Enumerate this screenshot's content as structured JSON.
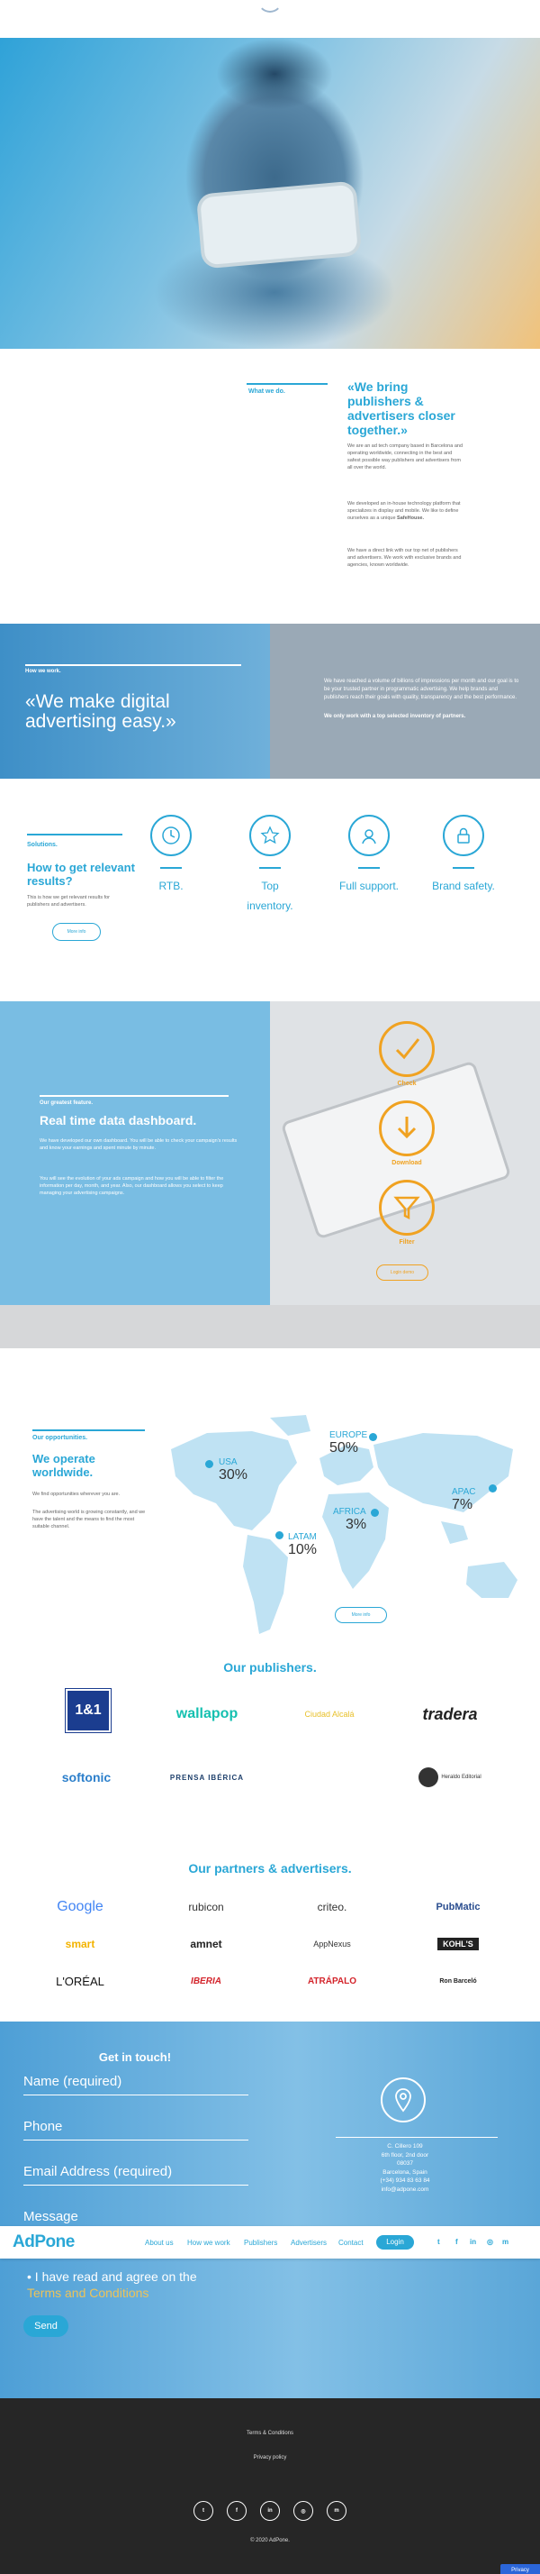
{
  "who": {
    "tag": "What we do.",
    "title": "«We bring publishers & advertisers closer together.»",
    "p1": "We are an ad tech company based in Barcelona and operating worldwide, connecting in the best and safest possible way publishers and advertisers from all over the world.",
    "p2": "We developed an in-house technology platform that specializes in display and mobile. We like to define ourselves as a unique",
    "p2_bold": "SafeHouse.",
    "p3": "We have a direct link with our top net of publishers and advertisers. We work with exclusive brands and agencies, known worldwide."
  },
  "how": {
    "tag": "How we work.",
    "title": "«We make digital advertising easy.»",
    "text": "We have reached a volume of billions of impressions per month and our goal is to be your trusted partner in programmatic advertising. We help brands and publishers reach their goals with quality, transparency and the best performance.",
    "bold": "We only work with a top selected inventory of partners."
  },
  "solutions": {
    "tag": "Solutions.",
    "title": "How to get relevant results?",
    "desc": "This is how we get relevant results for publishers and advertisers.",
    "more": "More info",
    "items": [
      {
        "label": "RTB."
      },
      {
        "label": "Top inventory."
      },
      {
        "label": "Full support."
      },
      {
        "label": "Brand safety."
      }
    ]
  },
  "dashboard": {
    "tag": "Our greatest feature.",
    "title": "Real time data dashboard.",
    "p1": "We have developed our own dashboard. You will be able to check your campaign's results and know your earnings and spent minute by minute.",
    "p2": "You will see the evolution of your ads campaign and how you will be able to filter the information per day, month, and year. Also, our dashboard allows you select to keep managing your advertising campaigns.",
    "steps": [
      {
        "label": "Check"
      },
      {
        "label": "Download"
      },
      {
        "label": "Filter"
      }
    ],
    "button": "Login demo"
  },
  "opportunities": {
    "tag": "Our opportunities.",
    "title": "We operate worldwide.",
    "p1": "We find opportunities wherever you are.",
    "p2": "The advertising world is growing constantly, and we have the talent and the means to find the most suitable channel.",
    "more": "More info",
    "regions": [
      {
        "name": "USA",
        "pct": "30%"
      },
      {
        "name": "EUROPE",
        "pct": "50%"
      },
      {
        "name": "APAC",
        "pct": "7%"
      },
      {
        "name": "AFRICA",
        "pct": "3%"
      },
      {
        "name": "LATAM",
        "pct": "10%"
      }
    ]
  },
  "publishers": {
    "title": "Our publishers.",
    "logos": [
      "1&1",
      "wallapop",
      "Ciudad Alcalá",
      "tradera",
      "softonic",
      "PRENSA IBÉRICA",
      "Heraldo Editorial"
    ]
  },
  "partners": {
    "title": "Our partners & advertisers.",
    "logos": [
      "Google",
      "rubicon",
      "criteo.",
      "PubMatic",
      "smart",
      "amnet",
      "AppNexus",
      "KOHL'S",
      "L'ORÉAL",
      "IBERIA",
      "ATRÁPALO",
      "Ron Barceló"
    ]
  },
  "contact": {
    "title": "Get in touch!",
    "fields": [
      "Name (required)",
      "Phone",
      "Email Address (required)",
      "Message"
    ],
    "address": [
      "C. Cillero 109",
      "6th floor, 2nd door",
      "08037",
      "Barcelona, Spain",
      "(+34) 934 83 63 84",
      "info@adpone.com"
    ],
    "consent_prefix": "I have read and agree on the",
    "consent_link": "Terms and Conditions",
    "send": "Send"
  },
  "nav": {
    "logo": "AdPone",
    "items": [
      "About us",
      "How we work",
      "Publishers",
      "Advertisers",
      "Contact"
    ],
    "login": "Login",
    "social": [
      "t",
      "f",
      "in",
      "◎",
      "m"
    ]
  },
  "footer": {
    "terms": "Terms & Conditions",
    "privacy": "Privacy policy",
    "social": [
      "t",
      "f",
      "in",
      "◎",
      "m"
    ],
    "copyright": "© 2020 AdPone.",
    "privacy_btn": "Privacy"
  },
  "colors": {
    "accent": "#2aa7d6",
    "orange": "#f0a221",
    "footer": "#262626"
  }
}
